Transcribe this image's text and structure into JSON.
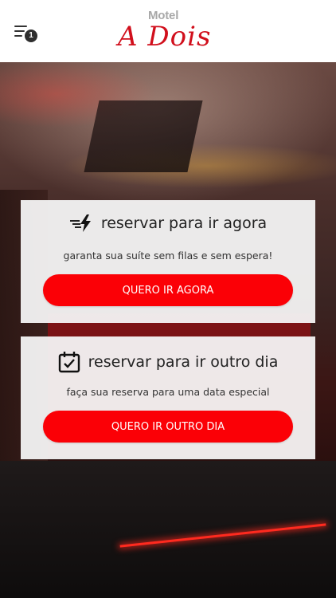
{
  "header": {
    "menu_icon": "hamburger-menu-icon",
    "notification_count": "1",
    "logo_top": "Motel",
    "logo_script": "A Dois"
  },
  "cards": [
    {
      "icon": "fast-lightning-icon",
      "title": "reservar para ir agora",
      "subtitle": "garanta sua suíte sem filas e sem espera!",
      "button_label": "QUERO IR AGORA"
    },
    {
      "icon": "calendar-check-icon",
      "title": "reservar para ir outro dia",
      "subtitle": "faça sua reserva para uma data especial",
      "button_label": "QUERO IR OUTRO DIA"
    }
  ],
  "colors": {
    "accent": "#fb0006",
    "logo_red": "#d10f1c",
    "card_bg": "#f4f4f4"
  }
}
